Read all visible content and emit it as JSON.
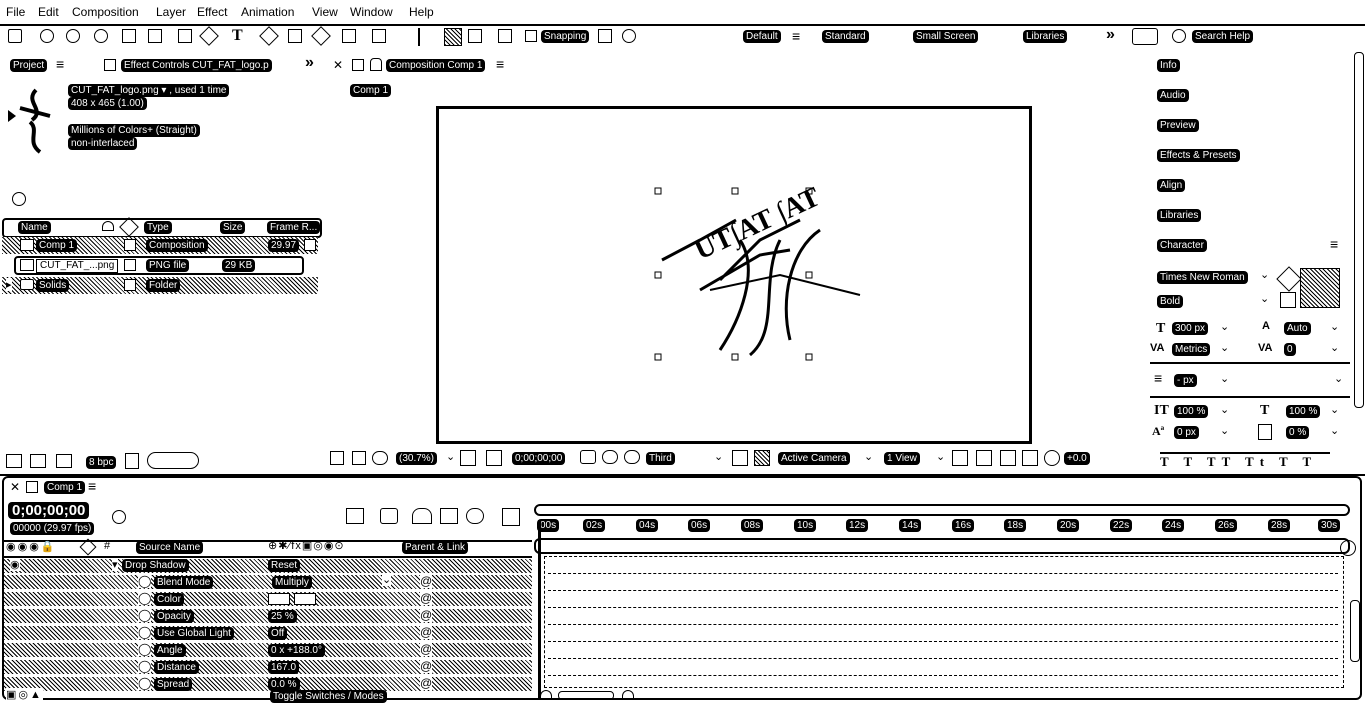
{
  "menu": [
    "File",
    "Edit",
    "Composition",
    "Layer",
    "Effect",
    "Animation",
    "View",
    "Window",
    "Help"
  ],
  "toolbar": {
    "snapping": "Snapping",
    "workspaces": [
      "Default",
      "Standard",
      "Small Screen",
      "Libraries"
    ],
    "search": "Search Help"
  },
  "project": {
    "tab": "Project",
    "effect_tab": "Effect Controls CUT_FAT_logo.p",
    "comp_tab": "Composition Comp 1",
    "comp_badge": "Comp 1",
    "asset_name": "CUT_FAT_logo.png ▾ , used 1 time",
    "asset_dims": "408 x 465 (1.00)",
    "asset_colors": "Millions of Colors+ (Straight)",
    "asset_interlace": "non-interlaced",
    "columns": [
      "Name",
      "Type",
      "Size",
      "Frame R..."
    ],
    "rows": [
      {
        "name": "Comp 1",
        "type": "Composition",
        "size": "",
        "fps": "29.97"
      },
      {
        "name": "CUT_FAT_...png",
        "type": "PNG file",
        "size": "29 KB",
        "fps": ""
      },
      {
        "name": "Solids",
        "type": "Folder",
        "size": "",
        "fps": ""
      }
    ],
    "bpc": "8 bpc"
  },
  "viewer": {
    "zoom": "(30.7%)",
    "timecode": "0;00;00;00",
    "resolution": "Third",
    "camera": "Active Camera",
    "views": "1 View",
    "exposure": "+0.0"
  },
  "right_panel": {
    "items": [
      "Info",
      "Audio",
      "Preview",
      "Effects & Presets",
      "Align",
      "Libraries",
      "Character"
    ],
    "font": "Times New Roman",
    "style": "Bold",
    "size": "300 px",
    "leading": "Auto",
    "kerning": "Metrics",
    "tracking": "0",
    "line": "- px",
    "vscale": "100 %",
    "hscale": "100 %",
    "baseline": "0 px",
    "tsume": "0 %"
  },
  "timeline": {
    "tab": "Comp 1",
    "time": "0;00;00;00",
    "frames": "00000 (29.97 fps)",
    "columns": {
      "source": "Source Name",
      "parent": "Parent & Link"
    },
    "ruler": [
      "00s",
      "02s",
      "04s",
      "06s",
      "08s",
      "10s",
      "12s",
      "14s",
      "16s",
      "18s",
      "20s",
      "22s",
      "24s",
      "26s",
      "28s",
      "30s"
    ],
    "effect": "Drop Shadow",
    "reset": "Reset",
    "props": [
      {
        "name": "Blend Mode",
        "value": "Multiply"
      },
      {
        "name": "Color",
        "value": ""
      },
      {
        "name": "Opacity",
        "value": "25 %"
      },
      {
        "name": "Use Global Light",
        "value": "Off"
      },
      {
        "name": "Angle",
        "value": "0 x +188.0°"
      },
      {
        "name": "Distance",
        "value": "167.0"
      },
      {
        "name": "Spread",
        "value": "0.0 %"
      }
    ],
    "toggle": "Toggle Switches / Modes"
  }
}
